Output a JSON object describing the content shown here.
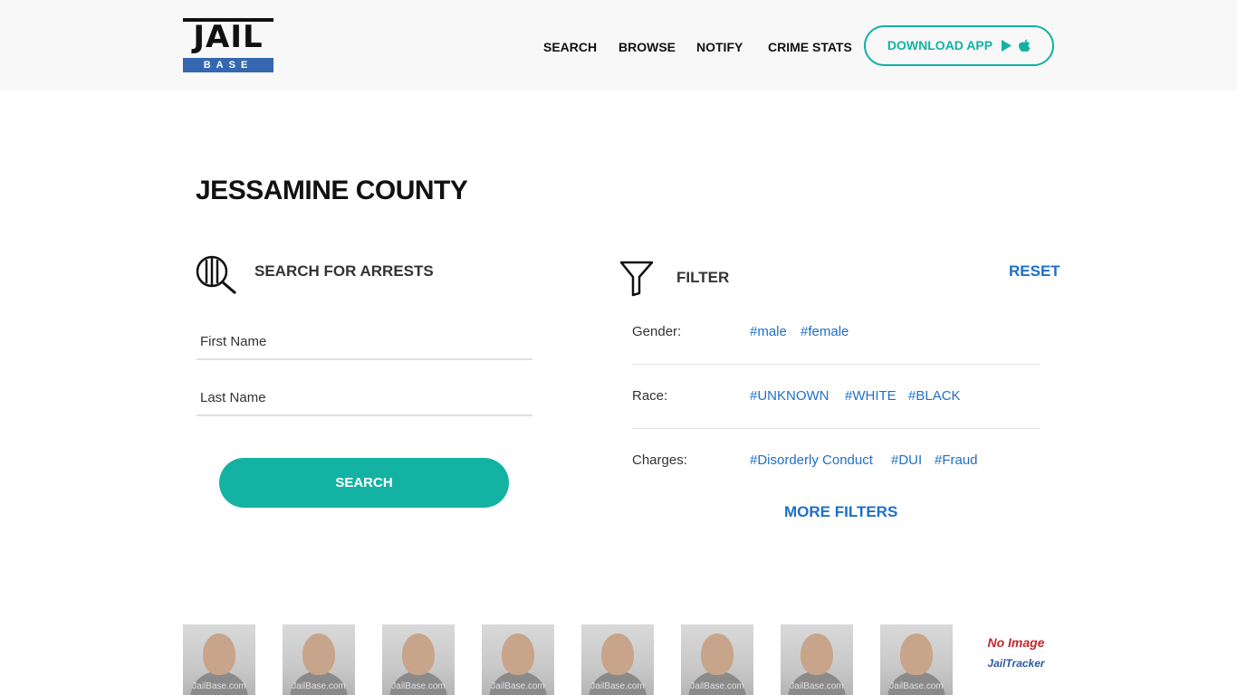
{
  "header": {
    "logo_top": "JAIL",
    "logo_bottom": "BASE",
    "nav": [
      "SEARCH",
      "BROWSE",
      "NOTIFY",
      "CRIME STATS"
    ],
    "download_label": "DOWNLOAD APP"
  },
  "page": {
    "title": "JESSAMINE COUNTY"
  },
  "search": {
    "title": "SEARCH FOR ARRESTS",
    "first_name_placeholder": "First Name",
    "last_name_placeholder": "Last Name",
    "button_label": "SEARCH"
  },
  "filter": {
    "title": "FILTER",
    "reset_label": "RESET",
    "rows": [
      {
        "label": "Gender:",
        "tags": [
          "#male",
          "#female"
        ]
      },
      {
        "label": "Race:",
        "tags": [
          "#UNKNOWN",
          "#WHITE",
          "#BLACK"
        ]
      },
      {
        "label": "Charges:",
        "tags": [
          "#Disorderly Conduct",
          "#DUI",
          "#Fraud"
        ]
      }
    ],
    "more_label": "MORE FILTERS"
  },
  "mugshots": {
    "watermark": "JailBase.com",
    "no_image_label": "No Image",
    "jailtracker_label": "JailTracker"
  },
  "colors": {
    "accent": "#13b2a3",
    "link": "#1e6fc7",
    "logo_blue": "#3467b0"
  }
}
